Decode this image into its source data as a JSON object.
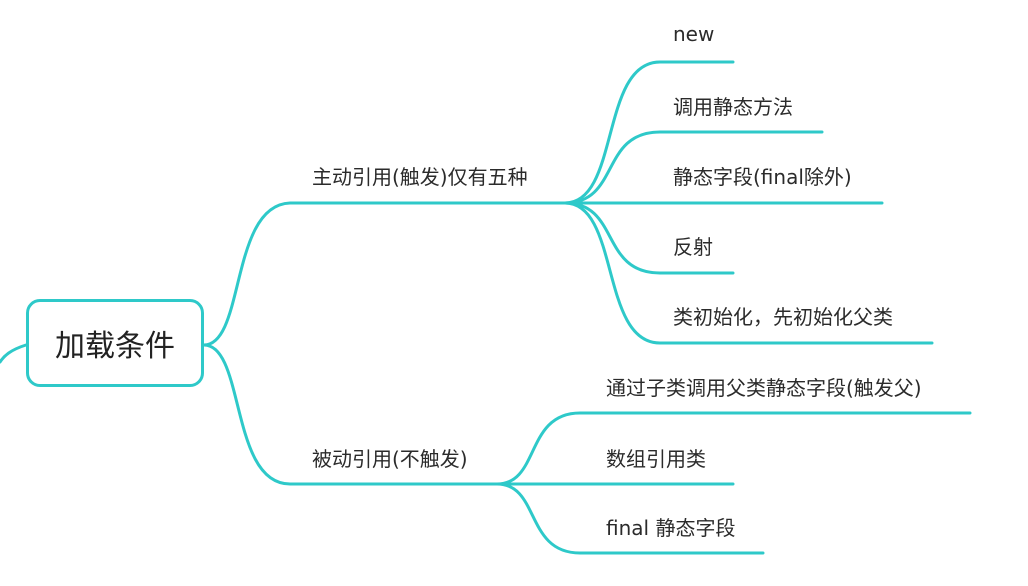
{
  "colors": {
    "branch": "#2ec9c9",
    "text": "#2b2b2b",
    "background": "#ffffff"
  },
  "root": {
    "label": "加载条件"
  },
  "branches": [
    {
      "label": "主动引用(触发)仅有五种",
      "children": [
        {
          "label": "new"
        },
        {
          "label": "调用静态方法"
        },
        {
          "label": "静态字段(final除外)"
        },
        {
          "label": "反射"
        },
        {
          "label": "类初始化，先初始化父类"
        }
      ]
    },
    {
      "label": "被动引用(不触发)",
      "children": [
        {
          "label": "通过子类调用父类静态字段(触发父)"
        },
        {
          "label": "数组引用类"
        },
        {
          "label": "final 静态字段"
        }
      ]
    }
  ]
}
